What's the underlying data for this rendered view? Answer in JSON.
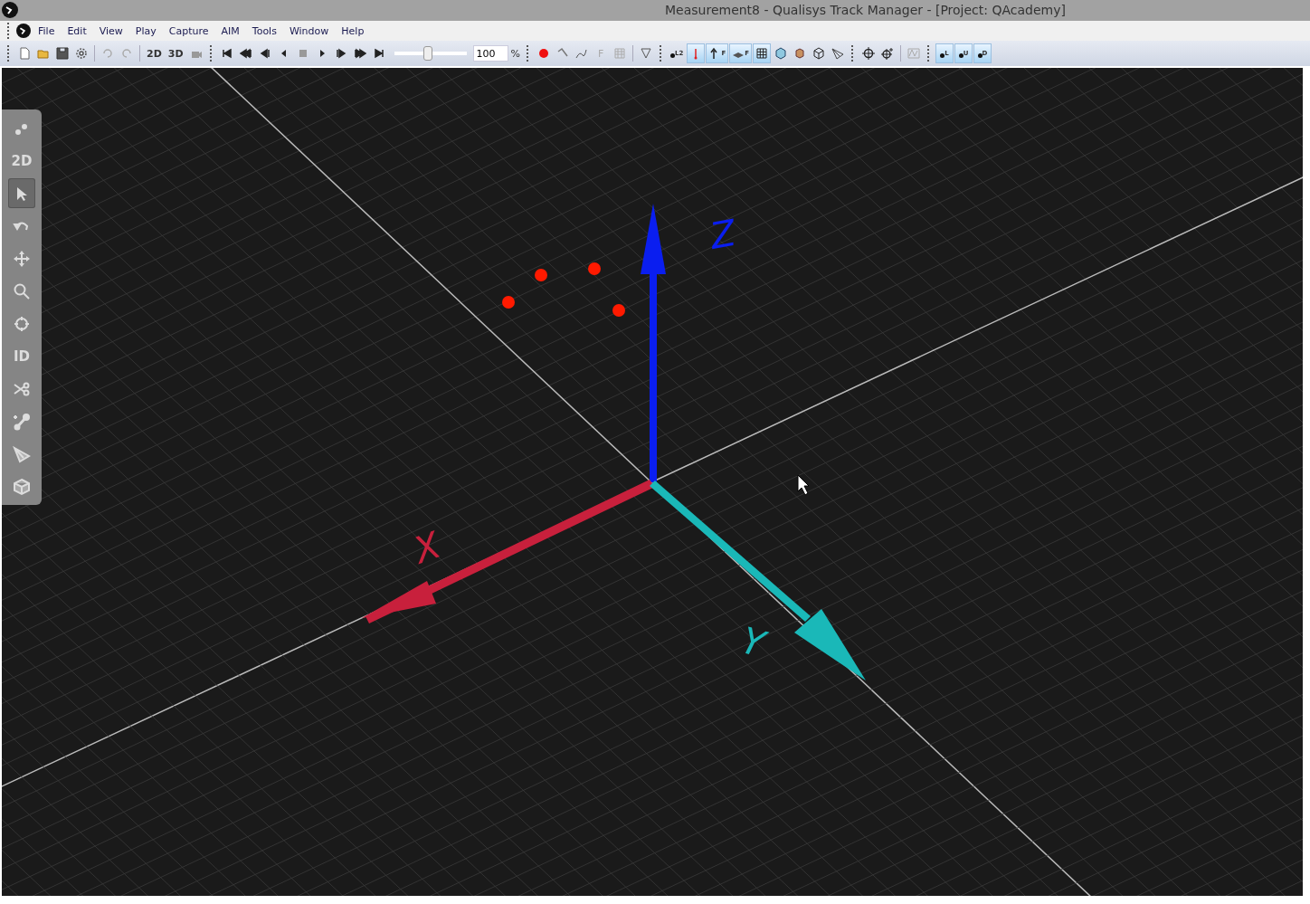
{
  "window": {
    "title": "Measurement8 - Qualisys Track Manager - [Project: QAcademy]"
  },
  "menu": [
    "File",
    "Edit",
    "View",
    "Play",
    "Capture",
    "AIM",
    "Tools",
    "Window",
    "Help"
  ],
  "toolbar": {
    "view_2d": "2D",
    "view_3d": "3D",
    "speed": "100",
    "speed_unit": "%",
    "speed_slider": {
      "level": 0.45
    },
    "force_label": "F",
    "label_l2": "L2",
    "toggles": [
      {
        "kind": "trace",
        "on": true
      },
      {
        "kind": "force-arrow",
        "label": "F",
        "on": true
      },
      {
        "kind": "force-plate",
        "label": "F",
        "on": true
      },
      {
        "kind": "grid",
        "on": true
      }
    ],
    "labels": [
      {
        "label": "L",
        "on": true
      },
      {
        "label": "U",
        "on": true
      },
      {
        "label": "D",
        "on": true
      }
    ]
  },
  "palette": {
    "items": [
      {
        "kind": "markers",
        "selected": false
      },
      {
        "kind": "text",
        "label": "2D",
        "selected": false
      },
      {
        "kind": "pointer",
        "selected": true
      },
      {
        "kind": "rotate",
        "selected": false
      },
      {
        "kind": "move",
        "selected": false
      },
      {
        "kind": "zoom",
        "selected": false
      },
      {
        "kind": "center",
        "selected": false
      },
      {
        "kind": "text",
        "label": "ID",
        "selected": false
      },
      {
        "kind": "cut",
        "selected": false
      },
      {
        "kind": "bone",
        "selected": false
      },
      {
        "kind": "camera",
        "selected": false
      },
      {
        "kind": "cube",
        "selected": false
      }
    ]
  },
  "viewport": {
    "axes": [
      {
        "label": "Z",
        "color": "#0a1ef0"
      },
      {
        "label": "X",
        "color": "#c8203c"
      },
      {
        "label": "Y",
        "color": "#1ab8b8"
      }
    ]
  }
}
